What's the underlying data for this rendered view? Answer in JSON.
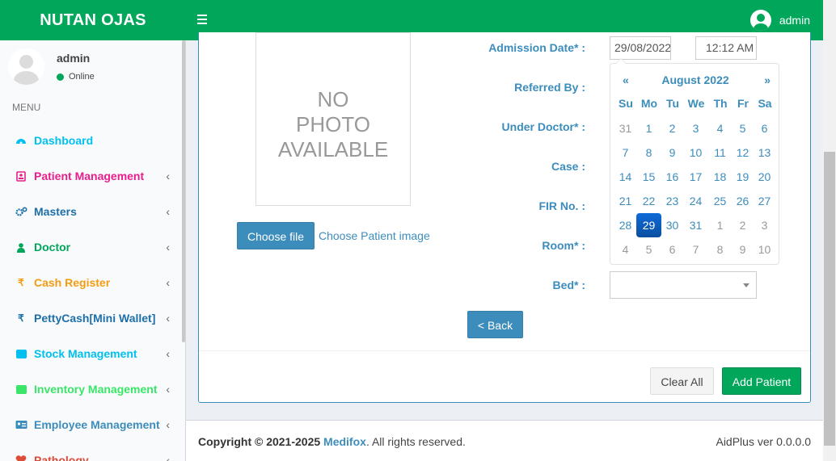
{
  "header": {
    "brand": "NUTAN OJAS",
    "user": "admin"
  },
  "sidebar": {
    "user_name": "admin",
    "status": "Online",
    "menu_header": "MENU",
    "items": [
      {
        "label": "Dashboard",
        "color": "#00c0ef",
        "icon": "dashboard-icon"
      },
      {
        "label": "Patient Management",
        "color": "#e91e8c",
        "icon": "patient-card-icon"
      },
      {
        "label": "Masters",
        "color": "#1e6fa8",
        "icon": "cogs-icon"
      },
      {
        "label": "Doctor",
        "color": "#00a65a",
        "icon": "user-md-icon"
      },
      {
        "label": "Cash Register",
        "color": "#f39c12",
        "icon": "rupee-icon"
      },
      {
        "label": "PettyCash[Mini Wallet]",
        "color": "#1e6fa8",
        "icon": "rupee-icon"
      },
      {
        "label": "Stock Management",
        "color": "#00c0ef",
        "icon": "briefcase-icon"
      },
      {
        "label": "Inventory Management",
        "color": "#39e667",
        "icon": "briefcase-icon"
      },
      {
        "label": "Employee Management",
        "color": "#3c8dbc",
        "icon": "id-card-icon"
      },
      {
        "label": "Pathology",
        "color": "#dd4b39",
        "icon": "pathology-icon"
      }
    ]
  },
  "photo": {
    "line1": "NO",
    "line2": "PHOTO",
    "line3": "AVAILABLE",
    "choose_button": "Choose file",
    "choose_label": "Choose Patient image"
  },
  "form": {
    "admission_date_label": "Admission Date* :",
    "admission_date_value": "29/08/2022",
    "admission_time_value": "12:12 AM",
    "referred_by_label": "Referred By :",
    "under_doctor_label": "Under Doctor* :",
    "case_label": "Case :",
    "fir_label": "FIR No. :",
    "room_label": "Room* :",
    "bed_label": "Bed* :",
    "bed_value": ""
  },
  "datepicker": {
    "prev": "«",
    "next": "»",
    "title": "August 2022",
    "dow": [
      "Su",
      "Mo",
      "Tu",
      "We",
      "Th",
      "Fr",
      "Sa"
    ],
    "days": [
      [
        "31",
        "1",
        "2",
        "3",
        "4",
        "5",
        "6"
      ],
      [
        "7",
        "8",
        "9",
        "10",
        "11",
        "12",
        "13"
      ],
      [
        "14",
        "15",
        "16",
        "17",
        "18",
        "19",
        "20"
      ],
      [
        "21",
        "22",
        "23",
        "24",
        "25",
        "26",
        "27"
      ],
      [
        "28",
        "29",
        "30",
        "31",
        "1",
        "2",
        "3"
      ],
      [
        "4",
        "5",
        "6",
        "7",
        "8",
        "9",
        "10"
      ]
    ],
    "selected": "29"
  },
  "buttons": {
    "back": "< Back",
    "clear": "Clear All",
    "add": "Add Patient"
  },
  "footer": {
    "copyright_prefix": "Copyright © 2021-2025",
    "company": "Medifox",
    "rights": ". All rights reserved.",
    "version": "AidPlus ver 0.0.0.0"
  }
}
